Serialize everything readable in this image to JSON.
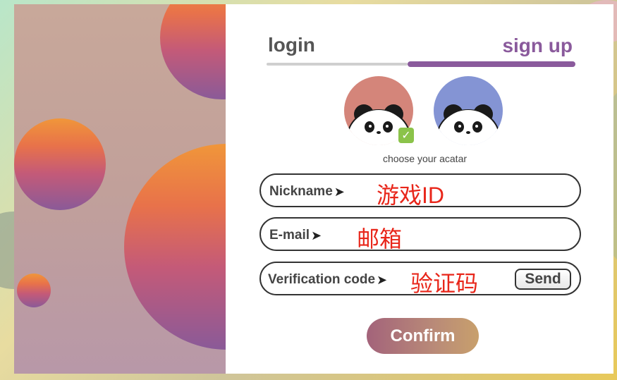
{
  "tabs": {
    "login": "login",
    "signup": "sign up",
    "active": "sign up"
  },
  "avatar": {
    "caption": "choose your acatar",
    "options": [
      "panda-red",
      "panda-blue"
    ],
    "selected": "panda-red"
  },
  "form": {
    "nickname": {
      "label": "Nickname",
      "value": "游戏ID"
    },
    "email": {
      "label": "E-mail",
      "value": "邮箱"
    },
    "verification": {
      "label": "Verification code",
      "value": "验证码",
      "send_label": "Send"
    }
  },
  "confirm_label": "Confirm",
  "colors": {
    "accent": "#8a5a9c",
    "field_annotation": "#e8261a",
    "avatar_red": "#d4857a",
    "avatar_blue": "#8494d4"
  }
}
